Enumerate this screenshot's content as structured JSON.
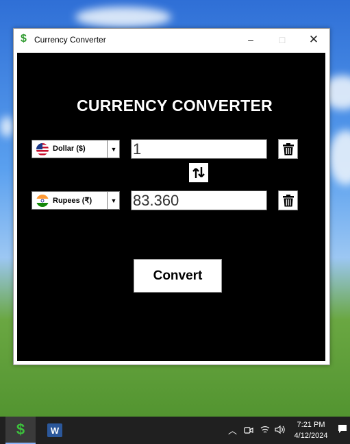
{
  "window": {
    "title": "Currency Converter",
    "app_icon": "$",
    "controls": {
      "minimize": "–",
      "maximize": "□",
      "close": "✕"
    }
  },
  "heading": "CURRENCY CONVERTER",
  "from": {
    "currency": "Dollar ($)",
    "flag": "us-flag-icon",
    "amount": "1"
  },
  "to": {
    "currency": "Rupees (₹)",
    "flag": "india-flag-icon",
    "amount": "83.360"
  },
  "convert_label": "Convert",
  "taskbar": {
    "apps": [
      "currency-converter",
      "word"
    ],
    "app_icon_dollar": "$",
    "app_icon_word": "W",
    "time": "7:21 PM",
    "date": "4/12/2024"
  },
  "colors": {
    "client_background": "#000000",
    "heading_text": "#ffffff",
    "app_icon_green": "#2f9a2f",
    "taskbar": "#202020"
  }
}
